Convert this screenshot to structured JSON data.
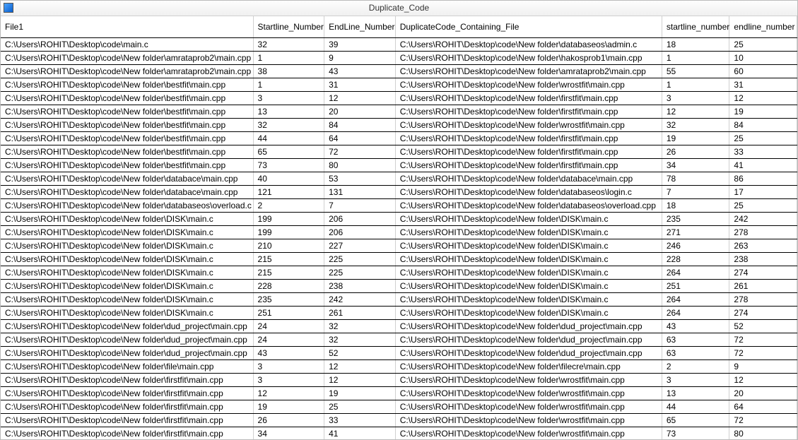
{
  "window": {
    "title": "Duplicate_Code"
  },
  "table": {
    "headers": {
      "file1": "File1",
      "startline": "Startline_Number",
      "endline": "EndLine_Number",
      "dupfile": "DuplicateCode_Containing_File",
      "startline2": "startline_number",
      "endline2": "endline_number"
    },
    "rows": [
      {
        "file1": "C:\\Users\\ROHIT\\Desktop\\code\\main.c",
        "sl": "32",
        "el": "39",
        "dup": "C:\\Users\\ROHIT\\Desktop\\code\\New folder\\databaseos\\admin.c",
        "sl2": "18",
        "el2": "25"
      },
      {
        "file1": "C:\\Users\\ROHIT\\Desktop\\code\\New folder\\amrataprob2\\main.cpp",
        "sl": "1",
        "el": "9",
        "dup": "C:\\Users\\ROHIT\\Desktop\\code\\New folder\\hakosprob1\\main.cpp",
        "sl2": "1",
        "el2": "10"
      },
      {
        "file1": "C:\\Users\\ROHIT\\Desktop\\code\\New folder\\amrataprob2\\main.cpp",
        "sl": "38",
        "el": "43",
        "dup": "C:\\Users\\ROHIT\\Desktop\\code\\New folder\\amrataprob2\\main.cpp",
        "sl2": "55",
        "el2": "60"
      },
      {
        "file1": "C:\\Users\\ROHIT\\Desktop\\code\\New folder\\bestfit\\main.cpp",
        "sl": "1",
        "el": "31",
        "dup": "C:\\Users\\ROHIT\\Desktop\\code\\New folder\\wrostfit\\main.cpp",
        "sl2": "1",
        "el2": "31"
      },
      {
        "file1": "C:\\Users\\ROHIT\\Desktop\\code\\New folder\\bestfit\\main.cpp",
        "sl": "3",
        "el": "12",
        "dup": "C:\\Users\\ROHIT\\Desktop\\code\\New folder\\firstfit\\main.cpp",
        "sl2": "3",
        "el2": "12"
      },
      {
        "file1": "C:\\Users\\ROHIT\\Desktop\\code\\New folder\\bestfit\\main.cpp",
        "sl": "13",
        "el": "20",
        "dup": "C:\\Users\\ROHIT\\Desktop\\code\\New folder\\firstfit\\main.cpp",
        "sl2": "12",
        "el2": "19"
      },
      {
        "file1": "C:\\Users\\ROHIT\\Desktop\\code\\New folder\\bestfit\\main.cpp",
        "sl": "32",
        "el": "84",
        "dup": "C:\\Users\\ROHIT\\Desktop\\code\\New folder\\wrostfit\\main.cpp",
        "sl2": "32",
        "el2": "84"
      },
      {
        "file1": "C:\\Users\\ROHIT\\Desktop\\code\\New folder\\bestfit\\main.cpp",
        "sl": "44",
        "el": "64",
        "dup": "C:\\Users\\ROHIT\\Desktop\\code\\New folder\\firstfit\\main.cpp",
        "sl2": "19",
        "el2": "25"
      },
      {
        "file1": "C:\\Users\\ROHIT\\Desktop\\code\\New folder\\bestfit\\main.cpp",
        "sl": "65",
        "el": "72",
        "dup": "C:\\Users\\ROHIT\\Desktop\\code\\New folder\\firstfit\\main.cpp",
        "sl2": "26",
        "el2": "33"
      },
      {
        "file1": "C:\\Users\\ROHIT\\Desktop\\code\\New folder\\bestfit\\main.cpp",
        "sl": "73",
        "el": "80",
        "dup": "C:\\Users\\ROHIT\\Desktop\\code\\New folder\\firstfit\\main.cpp",
        "sl2": "34",
        "el2": "41"
      },
      {
        "file1": "C:\\Users\\ROHIT\\Desktop\\code\\New folder\\databace\\main.cpp",
        "sl": "40",
        "el": "53",
        "dup": "C:\\Users\\ROHIT\\Desktop\\code\\New folder\\databace\\main.cpp",
        "sl2": "78",
        "el2": "86"
      },
      {
        "file1": "C:\\Users\\ROHIT\\Desktop\\code\\New folder\\databace\\main.cpp",
        "sl": "121",
        "el": "131",
        "dup": "C:\\Users\\ROHIT\\Desktop\\code\\New folder\\databaseos\\login.c",
        "sl2": "7",
        "el2": "17"
      },
      {
        "file1": "C:\\Users\\ROHIT\\Desktop\\code\\New folder\\databaseos\\overload.c",
        "sl": "2",
        "el": "7",
        "dup": "C:\\Users\\ROHIT\\Desktop\\code\\New folder\\databaseos\\overload.cpp",
        "sl2": "18",
        "el2": "25"
      },
      {
        "file1": "C:\\Users\\ROHIT\\Desktop\\code\\New folder\\DISK\\main.c",
        "sl": "199",
        "el": "206",
        "dup": "C:\\Users\\ROHIT\\Desktop\\code\\New folder\\DISK\\main.c",
        "sl2": "235",
        "el2": "242"
      },
      {
        "file1": "C:\\Users\\ROHIT\\Desktop\\code\\New folder\\DISK\\main.c",
        "sl": "199",
        "el": "206",
        "dup": "C:\\Users\\ROHIT\\Desktop\\code\\New folder\\DISK\\main.c",
        "sl2": "271",
        "el2": "278"
      },
      {
        "file1": "C:\\Users\\ROHIT\\Desktop\\code\\New folder\\DISK\\main.c",
        "sl": "210",
        "el": "227",
        "dup": "C:\\Users\\ROHIT\\Desktop\\code\\New folder\\DISK\\main.c",
        "sl2": "246",
        "el2": "263"
      },
      {
        "file1": "C:\\Users\\ROHIT\\Desktop\\code\\New folder\\DISK\\main.c",
        "sl": "215",
        "el": "225",
        "dup": "C:\\Users\\ROHIT\\Desktop\\code\\New folder\\DISK\\main.c",
        "sl2": "228",
        "el2": "238"
      },
      {
        "file1": "C:\\Users\\ROHIT\\Desktop\\code\\New folder\\DISK\\main.c",
        "sl": "215",
        "el": "225",
        "dup": "C:\\Users\\ROHIT\\Desktop\\code\\New folder\\DISK\\main.c",
        "sl2": "264",
        "el2": "274"
      },
      {
        "file1": "C:\\Users\\ROHIT\\Desktop\\code\\New folder\\DISK\\main.c",
        "sl": "228",
        "el": "238",
        "dup": "C:\\Users\\ROHIT\\Desktop\\code\\New folder\\DISK\\main.c",
        "sl2": "251",
        "el2": "261"
      },
      {
        "file1": "C:\\Users\\ROHIT\\Desktop\\code\\New folder\\DISK\\main.c",
        "sl": "235",
        "el": "242",
        "dup": "C:\\Users\\ROHIT\\Desktop\\code\\New folder\\DISK\\main.c",
        "sl2": "264",
        "el2": "278"
      },
      {
        "file1": "C:\\Users\\ROHIT\\Desktop\\code\\New folder\\DISK\\main.c",
        "sl": "251",
        "el": "261",
        "dup": "C:\\Users\\ROHIT\\Desktop\\code\\New folder\\DISK\\main.c",
        "sl2": "264",
        "el2": "274"
      },
      {
        "file1": "C:\\Users\\ROHIT\\Desktop\\code\\New folder\\dud_project\\main.cpp",
        "sl": "24",
        "el": "32",
        "dup": "C:\\Users\\ROHIT\\Desktop\\code\\New folder\\dud_project\\main.cpp",
        "sl2": "43",
        "el2": "52"
      },
      {
        "file1": "C:\\Users\\ROHIT\\Desktop\\code\\New folder\\dud_project\\main.cpp",
        "sl": "24",
        "el": "32",
        "dup": "C:\\Users\\ROHIT\\Desktop\\code\\New folder\\dud_project\\main.cpp",
        "sl2": "63",
        "el2": "72"
      },
      {
        "file1": "C:\\Users\\ROHIT\\Desktop\\code\\New folder\\dud_project\\main.cpp",
        "sl": "43",
        "el": "52",
        "dup": "C:\\Users\\ROHIT\\Desktop\\code\\New folder\\dud_project\\main.cpp",
        "sl2": "63",
        "el2": "72"
      },
      {
        "file1": "C:\\Users\\ROHIT\\Desktop\\code\\New folder\\file\\main.cpp",
        "sl": "3",
        "el": "12",
        "dup": "C:\\Users\\ROHIT\\Desktop\\code\\New folder\\filecre\\main.cpp",
        "sl2": "2",
        "el2": "9"
      },
      {
        "file1": "C:\\Users\\ROHIT\\Desktop\\code\\New folder\\firstfit\\main.cpp",
        "sl": "3",
        "el": "12",
        "dup": "C:\\Users\\ROHIT\\Desktop\\code\\New folder\\wrostfit\\main.cpp",
        "sl2": "3",
        "el2": "12"
      },
      {
        "file1": "C:\\Users\\ROHIT\\Desktop\\code\\New folder\\firstfit\\main.cpp",
        "sl": "12",
        "el": "19",
        "dup": "C:\\Users\\ROHIT\\Desktop\\code\\New folder\\wrostfit\\main.cpp",
        "sl2": "13",
        "el2": "20"
      },
      {
        "file1": "C:\\Users\\ROHIT\\Desktop\\code\\New folder\\firstfit\\main.cpp",
        "sl": "19",
        "el": "25",
        "dup": "C:\\Users\\ROHIT\\Desktop\\code\\New folder\\wrostfit\\main.cpp",
        "sl2": "44",
        "el2": "64"
      },
      {
        "file1": "C:\\Users\\ROHIT\\Desktop\\code\\New folder\\firstfit\\main.cpp",
        "sl": "26",
        "el": "33",
        "dup": "C:\\Users\\ROHIT\\Desktop\\code\\New folder\\wrostfit\\main.cpp",
        "sl2": "65",
        "el2": "72"
      },
      {
        "file1": "C:\\Users\\ROHIT\\Desktop\\code\\New folder\\firstfit\\main.cpp",
        "sl": "34",
        "el": "41",
        "dup": "C:\\Users\\ROHIT\\Desktop\\code\\New folder\\wrostfit\\main.cpp",
        "sl2": "73",
        "el2": "80"
      }
    ]
  }
}
